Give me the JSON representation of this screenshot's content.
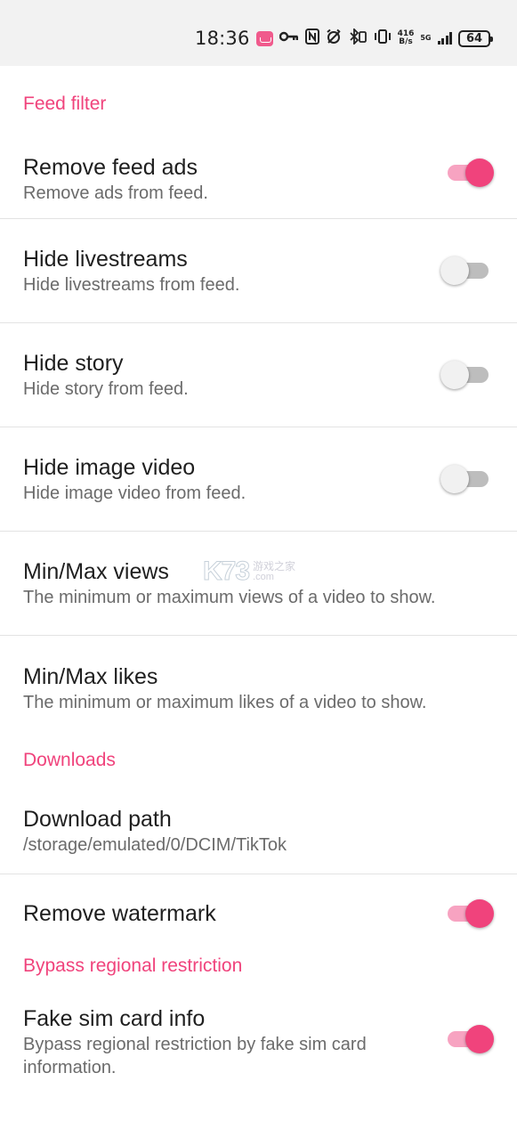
{
  "status_bar": {
    "time": "18:36",
    "speed_top": "416",
    "speed_bottom": "B/s",
    "network": "5G",
    "battery": "64",
    "icons": [
      "app-badge-icon",
      "key-icon",
      "nfc-icon",
      "alarm-icon",
      "bluetooth-icon",
      "vibrate-icon",
      "signal-icon",
      "battery-icon"
    ]
  },
  "accent_color": "#f0437c",
  "sections": {
    "feed_filter": {
      "header": "Feed filter",
      "remove_feed_ads": {
        "title": "Remove feed ads",
        "subtitle": "Remove ads from feed.",
        "enabled": true
      },
      "hide_livestreams": {
        "title": "Hide livestreams",
        "subtitle": "Hide livestreams from feed.",
        "enabled": false
      },
      "hide_story": {
        "title": "Hide story",
        "subtitle": "Hide story from feed.",
        "enabled": false
      },
      "hide_image_video": {
        "title": "Hide image video",
        "subtitle": "Hide image video from feed.",
        "enabled": false
      },
      "min_max_views": {
        "title": "Min/Max views",
        "subtitle": "The minimum or maximum views of a video to show."
      },
      "min_max_likes": {
        "title": "Min/Max likes",
        "subtitle": "The minimum or maximum likes of a video to show."
      }
    },
    "downloads": {
      "header": "Downloads",
      "download_path": {
        "title": "Download path",
        "subtitle": "/storage/emulated/0/DCIM/TikTok"
      },
      "remove_watermark": {
        "title": "Remove watermark",
        "enabled": true
      }
    },
    "bypass": {
      "header": "Bypass regional restriction",
      "fake_sim": {
        "title": "Fake sim card info",
        "subtitle": "Bypass regional restriction by fake sim card information.",
        "enabled": true
      }
    }
  },
  "watermark": {
    "logo": "K73",
    "cn": "游戏之家",
    "domain": ".com"
  }
}
